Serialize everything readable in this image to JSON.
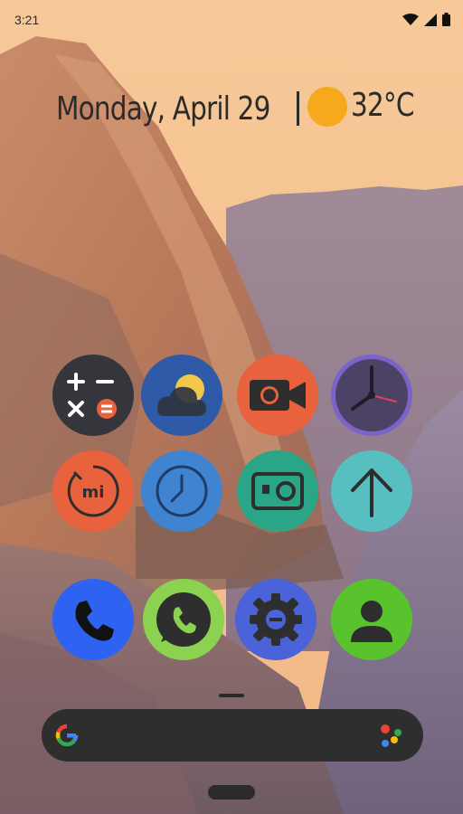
{
  "status_bar": {
    "time": "3:21",
    "icons": [
      "wifi-icon",
      "signal-icon",
      "battery-icon"
    ]
  },
  "widget": {
    "date": "Monday, April 29",
    "weather_icon": "sun-icon",
    "temperature": "32°C"
  },
  "app_icons": [
    {
      "name": "calculator-icon",
      "bg": "#34363b"
    },
    {
      "name": "weather-icon",
      "bg": "#2f5aa8"
    },
    {
      "name": "camera-icon",
      "bg": "#e8623e"
    },
    {
      "name": "clock-icon",
      "bg": "#6a5b94"
    },
    {
      "name": "mi-icon",
      "bg": "#e8623e"
    },
    {
      "name": "alarm-clock-icon",
      "bg": "#3f83d1"
    },
    {
      "name": "gallery-icon",
      "bg": "#2aa586"
    },
    {
      "name": "arrow-up-icon",
      "bg": "#58bfc0"
    },
    {
      "name": "phone-icon",
      "bg": "#2d63f0"
    },
    {
      "name": "whatsapp-icon",
      "bg": "#8ad24f"
    },
    {
      "name": "settings-icon",
      "bg": "#4a63d9"
    },
    {
      "name": "contacts-icon",
      "bg": "#58c32c"
    }
  ],
  "search_bar": {
    "google_icon": "google-icon",
    "assistant_icon": "assistant-icon"
  },
  "colors": {
    "sky": "#f6c89a",
    "widget_text": "#2b2b2b",
    "sun": "#f6a91a",
    "search_bar": "#2e2e2e"
  }
}
